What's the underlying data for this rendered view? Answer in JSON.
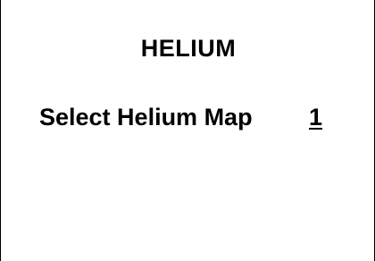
{
  "screen": {
    "title": "HELIUM",
    "setting": {
      "label": "Select Helium Map",
      "value": "1"
    }
  }
}
